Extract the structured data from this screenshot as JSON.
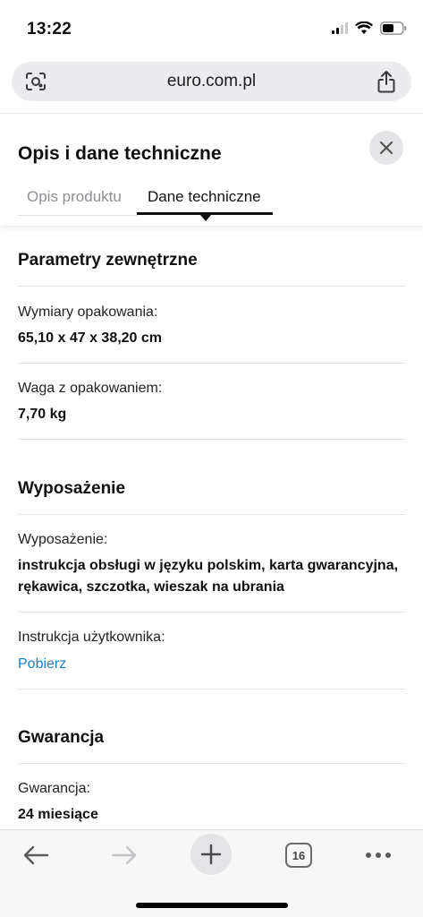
{
  "status_bar": {
    "time": "13:22"
  },
  "browser": {
    "url": "euro.com.pl",
    "left_icon": "lens-search-icon",
    "share_icon": "share-icon"
  },
  "panel": {
    "title": "Opis i dane techniczne",
    "close_icon": "close-icon",
    "tabs": [
      {
        "label": "Opis produktu",
        "active": false
      },
      {
        "label": "Dane techniczne",
        "active": true
      }
    ]
  },
  "sections": {
    "external": {
      "title": "Parametry zewnętrzne",
      "rows": [
        {
          "label": "Wymiary opakowania:",
          "value": "65,10 x 47 x 38,20 cm"
        },
        {
          "label": "Waga z opakowaniem:",
          "value": "7,70 kg"
        }
      ]
    },
    "equipment": {
      "title": "Wyposażenie",
      "rows": [
        {
          "label": "Wyposażenie:",
          "value": "instrukcja obsługi w języku polskim, karta gwarancyjna, rękawica, szczotka, wieszak na ubrania"
        },
        {
          "label": "Instrukcja użytkownika:",
          "link": "Pobierz"
        }
      ]
    },
    "warranty": {
      "title": "Gwarancja",
      "rows": [
        {
          "label": "Gwarancja:",
          "value": "24 miesiące"
        }
      ]
    }
  },
  "toolbar": {
    "back_icon": "back-arrow-icon",
    "forward_icon": "forward-arrow-icon",
    "new_tab_icon": "plus-icon",
    "tabs_count": "16",
    "more_icon": "more-dots-icon"
  },
  "colors": {
    "link": "#1b7fc4",
    "active_tab": "#111111",
    "inactive_tab": "#8e8e93"
  }
}
